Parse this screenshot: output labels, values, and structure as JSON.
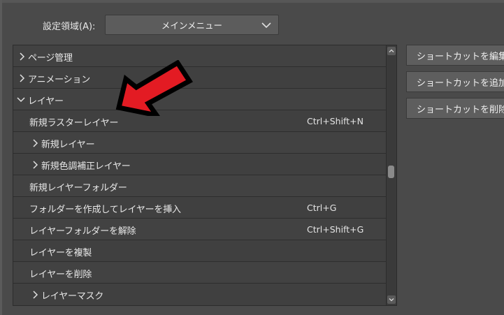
{
  "settings": {
    "area_label": "設定領域(A):",
    "area_value": "メインメニュー"
  },
  "tree": {
    "rows": [
      {
        "label": "ページ管理",
        "shortcut": "",
        "expander": "collapsed"
      },
      {
        "label": "アニメーション",
        "shortcut": "",
        "expander": "collapsed"
      },
      {
        "label": "レイヤー",
        "shortcut": "",
        "expander": "expanded"
      },
      {
        "label": "新規ラスターレイヤー",
        "shortcut": "Ctrl+Shift+N",
        "expander": "none"
      },
      {
        "label": "新規レイヤー",
        "shortcut": "",
        "expander": "collapsed"
      },
      {
        "label": "新規色調補正レイヤー",
        "shortcut": "",
        "expander": "collapsed"
      },
      {
        "label": "新規レイヤーフォルダー",
        "shortcut": "",
        "expander": "none"
      },
      {
        "label": "フォルダーを作成してレイヤーを挿入",
        "shortcut": "Ctrl+G",
        "expander": "none"
      },
      {
        "label": "レイヤーフォルダーを解除",
        "shortcut": "Ctrl+Shift+G",
        "expander": "none"
      },
      {
        "label": "レイヤーを複製",
        "shortcut": "",
        "expander": "none"
      },
      {
        "label": "レイヤーを削除",
        "shortcut": "",
        "expander": "none"
      },
      {
        "label": "レイヤーマスク",
        "shortcut": "",
        "expander": "collapsed"
      }
    ]
  },
  "buttons": {
    "edit": "ショートカットを編集",
    "add": "ショートカットを追加",
    "delete": "ショートカットを削除"
  },
  "annotation": {
    "arrow_fill": "#e31b23",
    "arrow_outline": "#000000"
  },
  "colors": {
    "background": "#4a4a4a",
    "list_background": "#424242",
    "text": "#e8e8e8"
  }
}
